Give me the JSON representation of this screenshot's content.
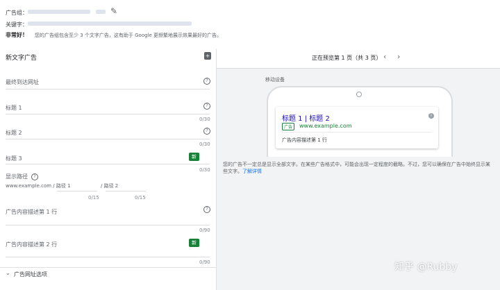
{
  "header": {
    "ad_group_label": "广告组：",
    "keywords_label": "关键字：",
    "tip_strong": "非常好！",
    "tip_text": "您的广告组包含至少 3 个文字广告，这有助于 Google 更频繁地展示效果最好的广告。"
  },
  "editor": {
    "title": "新文字广告",
    "final_url_label": "最终到达网址",
    "headline1_label": "标题 1",
    "headline1_count": "0/30",
    "headline2_label": "标题 2",
    "headline2_count": "0/30",
    "headline3_label": "标题 3",
    "headline3_badge": "新",
    "headline3_count": "0/30",
    "display_path_label": "显示路径",
    "display_path_base": "www.example.com / 路径 1",
    "path2_label": "/ 路径 2",
    "path1_count": "0/15",
    "path2_count": "0/15",
    "desc1_label": "广告内容描述第 1 行",
    "desc1_count": "0/90",
    "desc2_label": "广告内容描述第 2 行",
    "desc2_badge": "新",
    "desc2_count": "0/90",
    "url_options_label": "广告网址选项"
  },
  "preview": {
    "page_indicator": "正在预览第 1 页（共 3 页）",
    "device_label": "移动设备",
    "ad_title": "标题 1 | 标题 2",
    "ad_badge": "广告",
    "ad_url": "www.example.com",
    "ad_desc": "广告内容描述第 1 行",
    "notice_text": "您的广告不一定总是显示全部文字。在某些广告格式中，可能会出现一定程度的截略。不过，您可以确保在广告中始终显示某些文字。",
    "notice_link": "了解详情"
  },
  "watermark": "知乎 @Rubby"
}
